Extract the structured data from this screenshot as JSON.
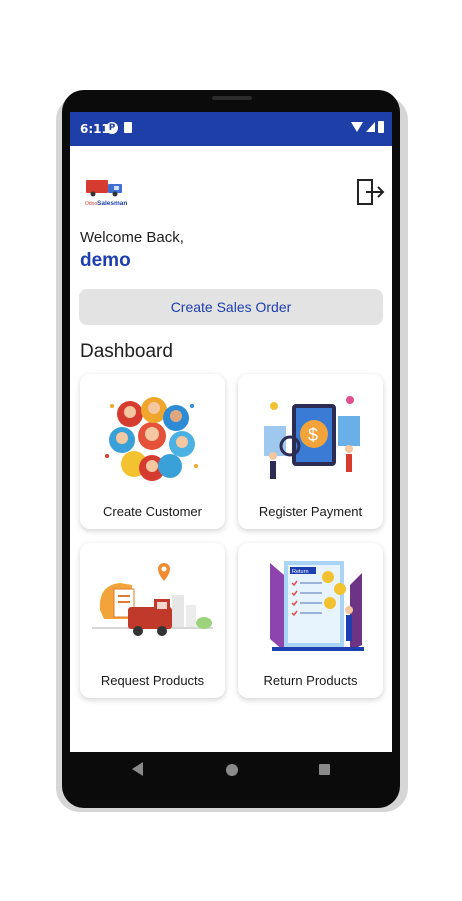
{
  "status_bar": {
    "time": "6:11"
  },
  "header": {
    "logo_text_small": "Odoo",
    "logo_text": "Salesman"
  },
  "welcome": {
    "greeting": "Welcome Back,",
    "username": "demo"
  },
  "actions": {
    "create_sales_order": "Create Sales Order"
  },
  "dashboard": {
    "title": "Dashboard",
    "cards": [
      {
        "label": "Create Customer"
      },
      {
        "label": "Register Payment"
      },
      {
        "label": "Request Products"
      },
      {
        "label": "Return Products"
      }
    ]
  },
  "colors": {
    "accent": "#1d3fb0",
    "status_bar": "#1f3fa8",
    "button_bg": "#e3e3e3"
  }
}
